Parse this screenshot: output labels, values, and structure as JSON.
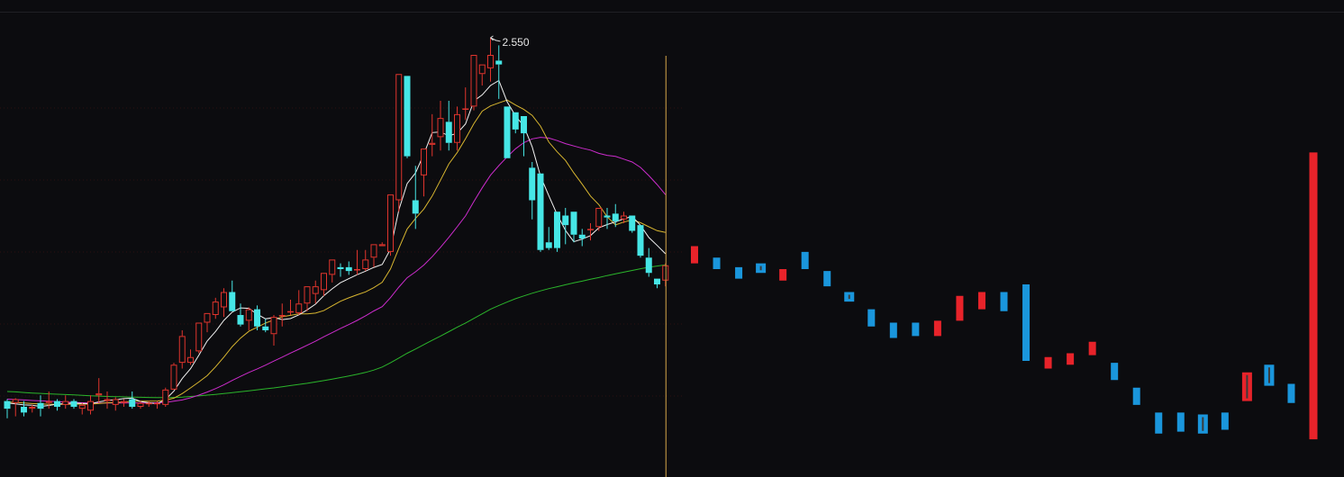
{
  "chart_data": {
    "type": "candlestick",
    "peak_label": "2.550",
    "y_range": [
      0.3,
      2.7
    ],
    "colors": {
      "background": "#0c0c0f",
      "up": "#e0342d",
      "down": "#46e6e6",
      "proj_up": "#e8232a",
      "proj_down": "#1a96dc",
      "ma5": "#f2f2f2",
      "ma10": "#d8b630",
      "ma20": "#cc2ccc",
      "ma60": "#2bb52b",
      "cursor": "#d7a64a",
      "grid": "#3a1214"
    },
    "candles": [
      {
        "o": 0.65,
        "h": 0.66,
        "l": 0.56,
        "c": 0.61
      },
      {
        "o": 0.64,
        "h": 0.665,
        "l": 0.57,
        "c": 0.66
      },
      {
        "o": 0.62,
        "h": 0.65,
        "l": 0.57,
        "c": 0.59
      },
      {
        "o": 0.61,
        "h": 0.63,
        "l": 0.59,
        "c": 0.62
      },
      {
        "o": 0.64,
        "h": 0.68,
        "l": 0.57,
        "c": 0.61
      },
      {
        "o": 0.64,
        "h": 0.7,
        "l": 0.61,
        "c": 0.65
      },
      {
        "o": 0.65,
        "h": 0.66,
        "l": 0.6,
        "c": 0.62
      },
      {
        "o": 0.63,
        "h": 0.68,
        "l": 0.61,
        "c": 0.65
      },
      {
        "o": 0.65,
        "h": 0.66,
        "l": 0.61,
        "c": 0.62
      },
      {
        "o": 0.61,
        "h": 0.64,
        "l": 0.58,
        "c": 0.63
      },
      {
        "o": 0.6,
        "h": 0.68,
        "l": 0.58,
        "c": 0.65
      },
      {
        "o": 0.68,
        "h": 0.77,
        "l": 0.64,
        "c": 0.69
      },
      {
        "o": 0.65,
        "h": 0.7,
        "l": 0.61,
        "c": 0.66
      },
      {
        "o": 0.63,
        "h": 0.67,
        "l": 0.6,
        "c": 0.66
      },
      {
        "o": 0.64,
        "h": 0.66,
        "l": 0.62,
        "c": 0.65
      },
      {
        "o": 0.66,
        "h": 0.7,
        "l": 0.61,
        "c": 0.62
      },
      {
        "o": 0.62,
        "h": 0.65,
        "l": 0.61,
        "c": 0.64
      },
      {
        "o": 0.64,
        "h": 0.65,
        "l": 0.62,
        "c": 0.64
      },
      {
        "o": 0.64,
        "h": 0.65,
        "l": 0.61,
        "c": 0.64
      },
      {
        "o": 0.63,
        "h": 0.72,
        "l": 0.62,
        "c": 0.71
      },
      {
        "o": 0.71,
        "h": 0.85,
        "l": 0.71,
        "c": 0.84
      },
      {
        "o": 0.85,
        "h": 1.02,
        "l": 0.82,
        "c": 0.99
      },
      {
        "o": 0.85,
        "h": 0.92,
        "l": 0.84,
        "c": 0.88
      },
      {
        "o": 0.91,
        "h": 1.06,
        "l": 0.9,
        "c": 1.06
      },
      {
        "o": 1.06,
        "h": 1.11,
        "l": 1.01,
        "c": 1.11
      },
      {
        "o": 1.1,
        "h": 1.19,
        "l": 1.08,
        "c": 1.17
      },
      {
        "o": 1.14,
        "h": 1.24,
        "l": 1.09,
        "c": 1.22
      },
      {
        "o": 1.22,
        "h": 1.28,
        "l": 1.12,
        "c": 1.12
      },
      {
        "o": 1.1,
        "h": 1.16,
        "l": 1.04,
        "c": 1.05
      },
      {
        "o": 1.07,
        "h": 1.14,
        "l": 1.02,
        "c": 1.13
      },
      {
        "o": 1.13,
        "h": 1.15,
        "l": 1.02,
        "c": 1.04
      },
      {
        "o": 1.04,
        "h": 1.08,
        "l": 1.01,
        "c": 1.02
      },
      {
        "o": 1.0,
        "h": 1.1,
        "l": 0.94,
        "c": 1.09
      },
      {
        "o": 1.1,
        "h": 1.16,
        "l": 1.04,
        "c": 1.1
      },
      {
        "o": 1.12,
        "h": 1.18,
        "l": 1.1,
        "c": 1.12
      },
      {
        "o": 1.11,
        "h": 1.23,
        "l": 1.1,
        "c": 1.16
      },
      {
        "o": 1.16,
        "h": 1.25,
        "l": 1.12,
        "c": 1.25
      },
      {
        "o": 1.21,
        "h": 1.28,
        "l": 1.16,
        "c": 1.25
      },
      {
        "o": 1.23,
        "h": 1.32,
        "l": 1.2,
        "c": 1.32
      },
      {
        "o": 1.31,
        "h": 1.36,
        "l": 1.27,
        "c": 1.39
      },
      {
        "o": 1.35,
        "h": 1.37,
        "l": 1.3,
        "c": 1.34
      },
      {
        "o": 1.35,
        "h": 1.38,
        "l": 1.31,
        "c": 1.33
      },
      {
        "o": 1.34,
        "h": 1.44,
        "l": 1.31,
        "c": 1.34
      },
      {
        "o": 1.34,
        "h": 1.44,
        "l": 1.33,
        "c": 1.39
      },
      {
        "o": 1.4,
        "h": 1.45,
        "l": 1.35,
        "c": 1.47
      },
      {
        "o": 1.46,
        "h": 1.48,
        "l": 1.47,
        "c": 1.47
      },
      {
        "o": 1.43,
        "h": 1.72,
        "l": 1.41,
        "c": 1.73
      },
      {
        "o": 1.7,
        "h": 2.36,
        "l": 1.64,
        "c": 2.36
      },
      {
        "o": 2.35,
        "h": 2.35,
        "l": 1.92,
        "c": 1.93
      },
      {
        "o": 1.7,
        "h": 1.88,
        "l": 1.55,
        "c": 1.63
      },
      {
        "o": 1.83,
        "h": 1.97,
        "l": 1.72,
        "c": 1.97
      },
      {
        "o": 1.99,
        "h": 2.15,
        "l": 1.93,
        "c": 2.0
      },
      {
        "o": 2.03,
        "h": 2.22,
        "l": 1.96,
        "c": 2.13
      },
      {
        "o": 2.11,
        "h": 2.22,
        "l": 1.96,
        "c": 2.0
      },
      {
        "o": 2.0,
        "h": 2.19,
        "l": 1.96,
        "c": 2.15
      },
      {
        "o": 2.18,
        "h": 2.29,
        "l": 2.12,
        "c": 2.18
      },
      {
        "o": 2.19,
        "h": 2.46,
        "l": 2.17,
        "c": 2.46
      },
      {
        "o": 2.36,
        "h": 2.4,
        "l": 2.3,
        "c": 2.41
      },
      {
        "o": 2.39,
        "h": 2.55,
        "l": 2.32,
        "c": 2.46
      },
      {
        "o": 2.43,
        "h": 2.51,
        "l": 2.23,
        "c": 2.41
      },
      {
        "o": 2.19,
        "h": 2.18,
        "l": 1.93,
        "c": 1.92
      },
      {
        "o": 2.16,
        "h": 2.16,
        "l": 2.05,
        "c": 2.07
      },
      {
        "o": 2.14,
        "h": 2.11,
        "l": 1.93,
        "c": 2.05
      },
      {
        "o": 1.87,
        "h": 1.9,
        "l": 1.6,
        "c": 1.7
      },
      {
        "o": 1.84,
        "h": 1.83,
        "l": 1.43,
        "c": 1.44
      },
      {
        "o": 1.48,
        "h": 1.56,
        "l": 1.44,
        "c": 1.45
      },
      {
        "o": 1.64,
        "h": 1.63,
        "l": 1.43,
        "c": 1.45
      },
      {
        "o": 1.62,
        "h": 1.66,
        "l": 1.47,
        "c": 1.57
      },
      {
        "o": 1.64,
        "h": 1.63,
        "l": 1.48,
        "c": 1.52
      },
      {
        "o": 1.52,
        "h": 1.55,
        "l": 1.46,
        "c": 1.5
      },
      {
        "o": 1.55,
        "h": 1.58,
        "l": 1.49,
        "c": 1.55
      },
      {
        "o": 1.56,
        "h": 1.65,
        "l": 1.54,
        "c": 1.66
      },
      {
        "o": 1.62,
        "h": 1.66,
        "l": 1.55,
        "c": 1.61
      },
      {
        "o": 1.63,
        "h": 1.68,
        "l": 1.56,
        "c": 1.59
      },
      {
        "o": 1.6,
        "h": 1.64,
        "l": 1.58,
        "c": 1.62
      },
      {
        "o": 1.62,
        "h": 1.62,
        "l": 1.53,
        "c": 1.54
      },
      {
        "o": 1.57,
        "h": 1.56,
        "l": 1.4,
        "c": 1.41
      },
      {
        "o": 1.4,
        "h": 1.45,
        "l": 1.3,
        "c": 1.32
      },
      {
        "o": 1.29,
        "h": 1.29,
        "l": 1.24,
        "c": 1.26
      },
      {
        "o": 1.28,
        "h": 1.37,
        "l": 1.25,
        "c": 1.36
      }
    ],
    "ma5": [
      0.64,
      0.635,
      0.63,
      0.628,
      0.622,
      0.627,
      0.634,
      0.637,
      0.64,
      0.638,
      0.636,
      0.646,
      0.653,
      0.657,
      0.663,
      0.665,
      0.648,
      0.641,
      0.636,
      0.658,
      0.702,
      0.768,
      0.819,
      0.89,
      0.964,
      1.014,
      1.072,
      1.115,
      1.137,
      1.135,
      1.104,
      1.08,
      1.087,
      1.076,
      1.081,
      1.101,
      1.127,
      1.157,
      1.201,
      1.237,
      1.269,
      1.29,
      1.311,
      1.329,
      1.349,
      1.364,
      1.445,
      1.65,
      1.787,
      1.843,
      1.941,
      2.054,
      2.057,
      2.037,
      2.05,
      2.099,
      2.219,
      2.251,
      2.3,
      2.326,
      2.215,
      2.141,
      2.088,
      1.979,
      1.826,
      1.723,
      1.625,
      1.542,
      1.483,
      1.497,
      1.515,
      1.556,
      1.573,
      1.587,
      1.603,
      1.616,
      1.569,
      1.505,
      1.464,
      1.42
    ],
    "ma10": [
      0.645,
      0.643,
      0.64,
      0.637,
      0.635,
      0.633,
      0.633,
      0.633,
      0.634,
      0.634,
      0.634,
      0.637,
      0.641,
      0.642,
      0.645,
      0.649,
      0.649,
      0.649,
      0.65,
      0.655,
      0.665,
      0.689,
      0.719,
      0.75,
      0.783,
      0.829,
      0.88,
      0.935,
      0.979,
      1.015,
      1.036,
      1.058,
      1.074,
      1.091,
      1.098,
      1.106,
      1.106,
      1.11,
      1.123,
      1.148,
      1.172,
      1.19,
      1.206,
      1.221,
      1.243,
      1.271,
      1.341,
      1.449,
      1.55,
      1.605,
      1.654,
      1.722,
      1.805,
      1.89,
      1.949,
      2.022,
      2.1,
      2.166,
      2.193,
      2.209,
      2.224,
      2.198,
      2.175,
      2.144,
      2.088,
      2.004,
      1.953,
      1.908,
      1.843,
      1.784,
      1.722,
      1.677,
      1.614,
      1.571,
      1.586,
      1.597,
      1.583,
      1.561,
      1.541,
      1.532
    ],
    "ma20": [
      0.66,
      0.658,
      0.656,
      0.653,
      0.651,
      0.649,
      0.647,
      0.645,
      0.643,
      0.641,
      0.64,
      0.64,
      0.64,
      0.64,
      0.64,
      0.64,
      0.64,
      0.64,
      0.641,
      0.643,
      0.649,
      0.656,
      0.667,
      0.681,
      0.697,
      0.715,
      0.735,
      0.758,
      0.779,
      0.8,
      0.818,
      0.838,
      0.859,
      0.88,
      0.901,
      0.921,
      0.942,
      0.963,
      0.986,
      1.008,
      1.03,
      1.05,
      1.072,
      1.096,
      1.121,
      1.144,
      1.191,
      1.246,
      1.295,
      1.326,
      1.361,
      1.405,
      1.454,
      1.506,
      1.561,
      1.618,
      1.693,
      1.765,
      1.831,
      1.881,
      1.927,
      1.969,
      2.001,
      2.021,
      2.029,
      2.025,
      2.012,
      1.996,
      1.984,
      1.972,
      1.962,
      1.945,
      1.935,
      1.929,
      1.915,
      1.9,
      1.872,
      1.829,
      1.782,
      1.729
    ],
    "ma60": [
      0.7,
      0.698,
      0.695,
      0.692,
      0.69,
      0.688,
      0.686,
      0.684,
      0.682,
      0.68,
      0.678,
      0.676,
      0.674,
      0.673,
      0.672,
      0.671,
      0.67,
      0.669,
      0.668,
      0.668,
      0.669,
      0.671,
      0.674,
      0.677,
      0.681,
      0.685,
      0.689,
      0.694,
      0.699,
      0.704,
      0.709,
      0.714,
      0.719,
      0.725,
      0.731,
      0.737,
      0.743,
      0.75,
      0.757,
      0.765,
      0.773,
      0.781,
      0.79,
      0.8,
      0.812,
      0.828,
      0.85,
      0.875,
      0.9,
      0.922,
      0.945,
      0.968,
      0.99,
      1.013,
      1.036,
      1.058,
      1.082,
      1.106,
      1.13,
      1.15,
      1.168,
      1.185,
      1.2,
      1.214,
      1.226,
      1.238,
      1.248,
      1.258,
      1.268,
      1.277,
      1.287,
      1.296,
      1.306,
      1.315,
      1.324,
      1.333,
      1.342,
      1.35,
      1.356,
      1.362
    ],
    "projection": [
      {
        "dir": "up",
        "top": 1.46,
        "bottom": 1.37
      },
      {
        "dir": "down",
        "top": 1.4,
        "bottom": 1.34
      },
      {
        "dir": "down",
        "top": 1.35,
        "bottom": 1.29
      },
      {
        "dir": "down",
        "top": 1.37,
        "bottom": 1.32,
        "inner": true
      },
      {
        "dir": "up",
        "top": 1.34,
        "bottom": 1.28
      },
      {
        "dir": "down",
        "top": 1.43,
        "bottom": 1.34
      },
      {
        "dir": "down",
        "top": 1.33,
        "bottom": 1.25
      },
      {
        "dir": "down",
        "top": 1.22,
        "bottom": 1.17,
        "inner": true
      },
      {
        "dir": "down",
        "top": 1.13,
        "bottom": 1.04
      },
      {
        "dir": "down",
        "top": 1.06,
        "bottom": 0.98
      },
      {
        "dir": "down",
        "top": 1.06,
        "bottom": 0.99
      },
      {
        "dir": "up",
        "top": 1.07,
        "bottom": 0.99
      },
      {
        "dir": "up",
        "top": 1.2,
        "bottom": 1.07
      },
      {
        "dir": "up",
        "top": 1.22,
        "bottom": 1.13
      },
      {
        "dir": "down",
        "top": 1.22,
        "bottom": 1.12
      },
      {
        "dir": "down",
        "top": 1.26,
        "bottom": 0.86
      },
      {
        "dir": "up",
        "top": 0.88,
        "bottom": 0.82
      },
      {
        "dir": "up",
        "top": 0.9,
        "bottom": 0.84
      },
      {
        "dir": "up",
        "top": 0.96,
        "bottom": 0.89
      },
      {
        "dir": "down",
        "top": 0.85,
        "bottom": 0.76
      },
      {
        "dir": "down",
        "top": 0.72,
        "bottom": 0.63
      },
      {
        "dir": "down",
        "top": 0.59,
        "bottom": 0.48
      },
      {
        "dir": "down",
        "top": 0.59,
        "bottom": 0.49
      },
      {
        "dir": "down",
        "top": 0.58,
        "bottom": 0.48,
        "inner": true
      },
      {
        "dir": "down",
        "top": 0.59,
        "bottom": 0.5
      },
      {
        "dir": "up",
        "top": 0.8,
        "bottom": 0.65,
        "outline": true
      },
      {
        "dir": "down",
        "top": 0.84,
        "bottom": 0.73,
        "inner": true
      },
      {
        "dir": "down",
        "top": 0.74,
        "bottom": 0.64
      },
      {
        "dir": "up",
        "top": 1.95,
        "bottom": 0.45
      }
    ]
  }
}
